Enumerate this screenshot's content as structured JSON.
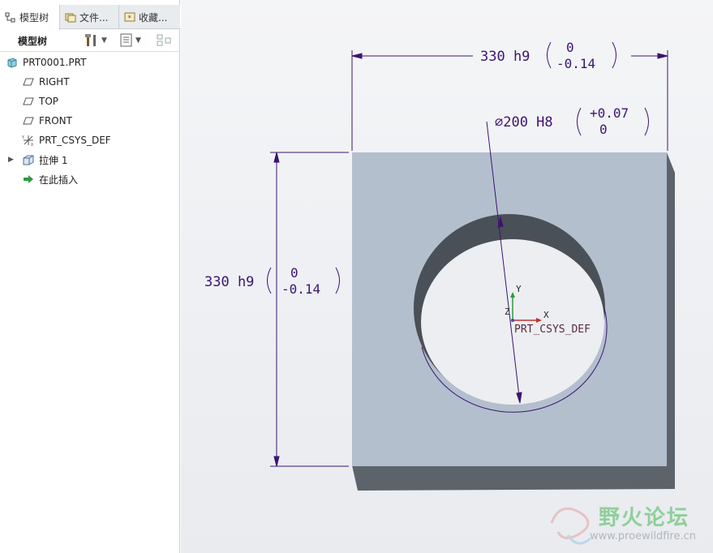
{
  "tabs": [
    {
      "label": "模型树",
      "icon": "model-tree-icon"
    },
    {
      "label": "文件...",
      "icon": "folder-icon"
    },
    {
      "label": "收藏...",
      "icon": "favorites-icon"
    }
  ],
  "toolbar": {
    "title": "模型树",
    "settings_icon": "tools-icon",
    "show_icon": "list-icon",
    "filter_icon": "filter-icon"
  },
  "tree": {
    "root": "PRT0001.PRT",
    "items": [
      {
        "label": "RIGHT",
        "icon": "datum-plane-icon"
      },
      {
        "label": "TOP",
        "icon": "datum-plane-icon"
      },
      {
        "label": "FRONT",
        "icon": "datum-plane-icon"
      },
      {
        "label": "PRT_CSYS_DEF",
        "icon": "coordinate-system-icon"
      },
      {
        "label": "拉伸 1",
        "icon": "extrude-icon"
      },
      {
        "label": "在此插入",
        "icon": "insert-here-arrow-icon"
      }
    ]
  },
  "drawing": {
    "dim_top_nominal": "330 h9",
    "dim_top_upper": "0",
    "dim_top_lower": "-0.14",
    "dim_left_nominal": "330 h9",
    "dim_left_upper": "0",
    "dim_left_lower": "-0.14",
    "dim_diam_nominal": "⌀200 H8",
    "dim_diam_upper": "+0.07",
    "dim_diam_lower": "0",
    "csys_label": "PRT_CSYS_DEF",
    "axis_x": "X",
    "axis_y": "Y",
    "axis_z": "Z",
    "plate_color": "#b3bfcd",
    "side_color": "#5c636b",
    "dim_color": "#3b1470"
  },
  "watermark": {
    "text": "野火论坛",
    "url": "www.proewildfire.cn"
  }
}
